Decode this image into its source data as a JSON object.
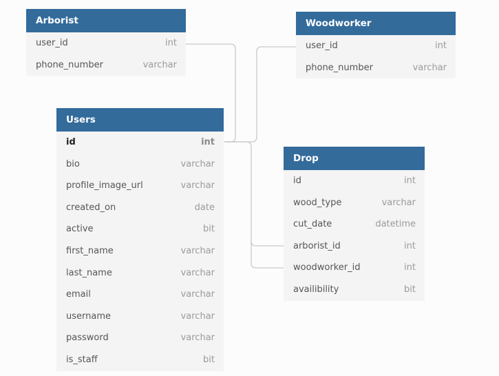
{
  "colors": {
    "header": "#336b9b",
    "link": "#c8c8c8"
  },
  "tables": {
    "arborist": {
      "title": "Arborist",
      "columns": [
        {
          "name": "user_id",
          "type": "int"
        },
        {
          "name": "phone_number",
          "type": "varchar"
        }
      ]
    },
    "woodworker": {
      "title": "Woodworker",
      "columns": [
        {
          "name": "user_id",
          "type": "int"
        },
        {
          "name": "phone_number",
          "type": "varchar"
        }
      ]
    },
    "users": {
      "title": "Users",
      "columns": [
        {
          "name": "id",
          "type": "int"
        },
        {
          "name": "bio",
          "type": "varchar"
        },
        {
          "name": "profile_image_url",
          "type": "varchar"
        },
        {
          "name": "created_on",
          "type": "date"
        },
        {
          "name": "active",
          "type": "bit"
        },
        {
          "name": "first_name",
          "type": "varchar"
        },
        {
          "name": "last_name",
          "type": "varchar"
        },
        {
          "name": "email",
          "type": "varchar"
        },
        {
          "name": "username",
          "type": "varchar"
        },
        {
          "name": "password",
          "type": "varchar"
        },
        {
          "name": "is_staff",
          "type": "bit"
        }
      ]
    },
    "drop": {
      "title": "Drop",
      "columns": [
        {
          "name": "id",
          "type": "int"
        },
        {
          "name": "wood_type",
          "type": "varchar"
        },
        {
          "name": "cut_date",
          "type": "datetime"
        },
        {
          "name": "arborist_id",
          "type": "int"
        },
        {
          "name": "woodworker_id",
          "type": "int"
        },
        {
          "name": "availibility",
          "type": "bit"
        }
      ]
    }
  }
}
